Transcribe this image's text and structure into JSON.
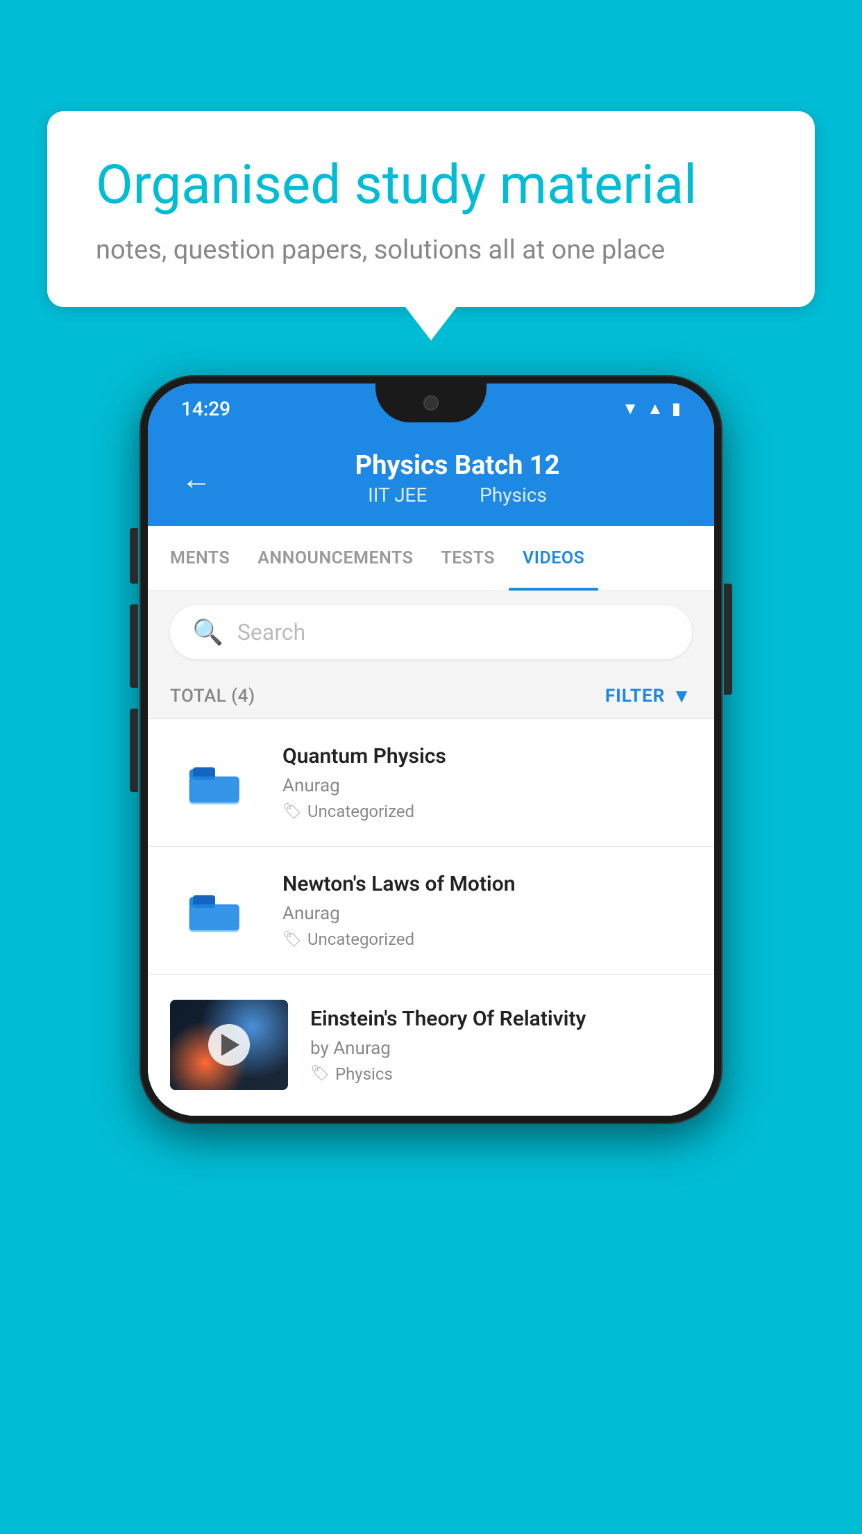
{
  "background_color": "#00BCD4",
  "speech_bubble": {
    "title": "Organised study material",
    "subtitle": "notes, question papers, solutions all at one place"
  },
  "status_bar": {
    "time": "14:29",
    "icons": [
      "wifi",
      "signal",
      "battery"
    ]
  },
  "header": {
    "title": "Physics Batch 12",
    "subtitle_part1": "IIT JEE",
    "subtitle_part2": "Physics",
    "back_label": "back"
  },
  "tabs": [
    {
      "label": "MENTS",
      "active": false
    },
    {
      "label": "ANNOUNCEMENTS",
      "active": false
    },
    {
      "label": "TESTS",
      "active": false
    },
    {
      "label": "VIDEOS",
      "active": true
    }
  ],
  "search": {
    "placeholder": "Search"
  },
  "filter_bar": {
    "total_label": "TOTAL (4)",
    "filter_label": "FILTER"
  },
  "videos": [
    {
      "id": 1,
      "title": "Quantum Physics",
      "author": "Anurag",
      "tag": "Uncategorized",
      "has_thumb": false
    },
    {
      "id": 2,
      "title": "Newton's Laws of Motion",
      "author": "Anurag",
      "tag": "Uncategorized",
      "has_thumb": false
    },
    {
      "id": 3,
      "title": "Einstein's Theory Of Relativity",
      "author": "by Anurag",
      "tag": "Physics",
      "has_thumb": true
    }
  ]
}
